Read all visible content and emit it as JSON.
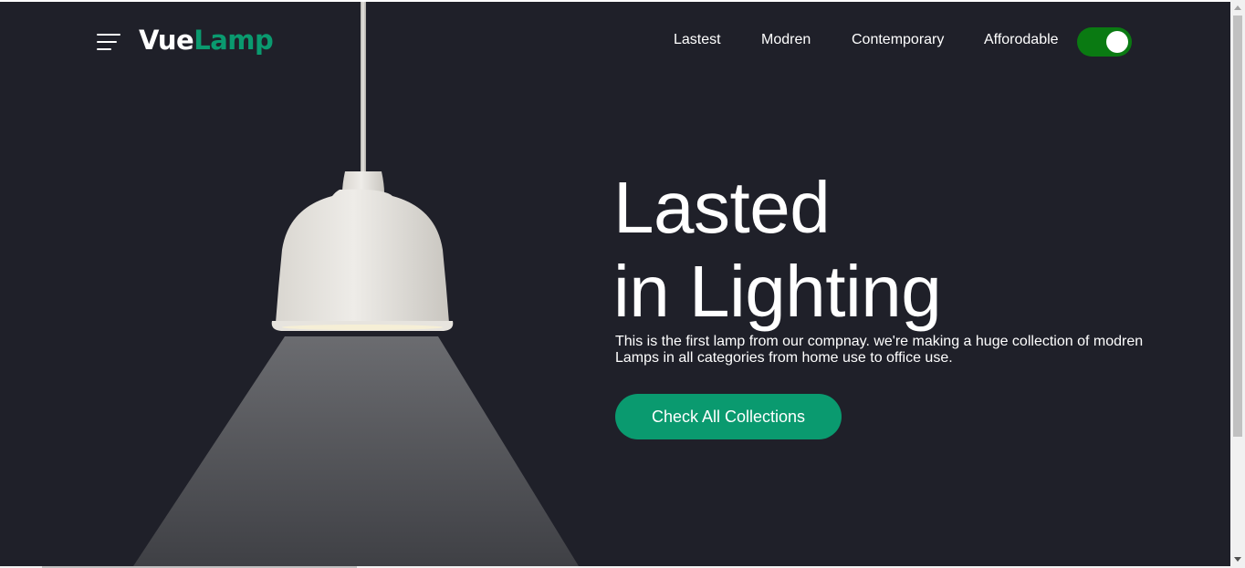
{
  "header": {
    "logo_part1": "Vue",
    "logo_part2": "Lamp",
    "nav": [
      {
        "label": "Lastest"
      },
      {
        "label": "Modren"
      },
      {
        "label": "Contemporary"
      },
      {
        "label": "Afforodable"
      }
    ],
    "toggle_on": true
  },
  "hero": {
    "title_line1": "Lasted",
    "title_line2": "in Lighting",
    "description": "This is the first lamp from our compnay. we're making a huge collection of modren Lamps in all categories from home use to office use.",
    "cta_label": "Check All Collections"
  },
  "colors": {
    "background": "#1f2029",
    "accent": "#0a9a6f",
    "toggle": "#0a7a12",
    "text": "#ffffff"
  }
}
